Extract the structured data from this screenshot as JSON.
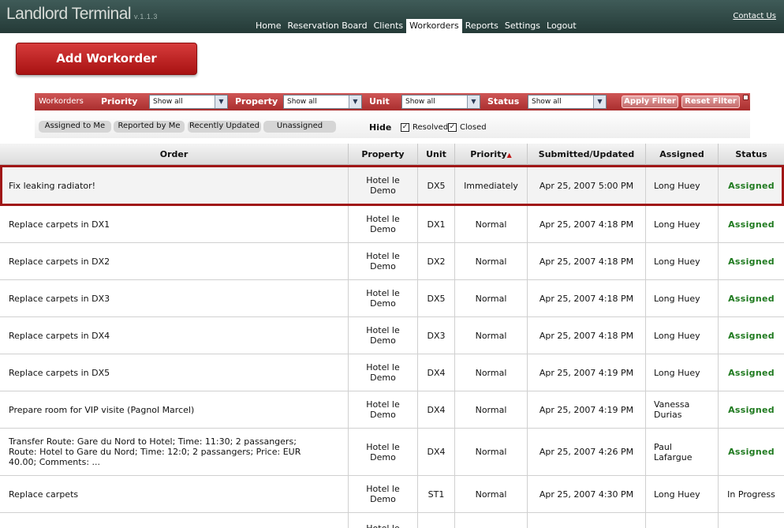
{
  "app": {
    "title": "Landlord Terminal",
    "version": "v.1.1.3",
    "contact": "Contact Us"
  },
  "nav": [
    {
      "label": "Home",
      "active": false
    },
    {
      "label": "Reservation Board",
      "active": false
    },
    {
      "label": "Clients",
      "active": false
    },
    {
      "label": "Workorders",
      "active": true
    },
    {
      "label": "Reports",
      "active": false
    },
    {
      "label": "Settings",
      "active": false
    },
    {
      "label": "Logout",
      "active": false
    }
  ],
  "add_button": "Add Workorder",
  "filter": {
    "section": "Workorders",
    "priority_label": "Priority",
    "priority_value": "Show all",
    "property_label": "Property",
    "property_value": "Show all",
    "unit_label": "Unit",
    "unit_value": "Show all",
    "status_label": "Status",
    "status_value": "Show all",
    "apply": "Apply Filter",
    "reset": "Reset Filter"
  },
  "quick_filters": [
    "Assigned to Me",
    "Reported by Me",
    "Recently Updated",
    "Unassigned"
  ],
  "hide": {
    "label": "Hide",
    "resolved": "Resolved",
    "closed": "Closed",
    "resolved_checked": true,
    "closed_checked": true
  },
  "columns": [
    "Order",
    "Property",
    "Unit",
    "Priority",
    "Submitted/Updated",
    "Assigned",
    "Status"
  ],
  "sort": {
    "column": "Priority"
  },
  "rows": [
    {
      "order": "Fix leaking radiator!",
      "property": "Hotel le Demo",
      "unit": "DX5",
      "priority": "Immediately",
      "submitted": "Apr 25, 2007 5:00 PM",
      "assigned": "Long Huey",
      "status": "Assigned",
      "selected": true
    },
    {
      "order": "Replace carpets in DX1",
      "property": "Hotel le Demo",
      "unit": "DX1",
      "priority": "Normal",
      "submitted": "Apr 25, 2007 4:18 PM",
      "assigned": "Long Huey",
      "status": "Assigned"
    },
    {
      "order": "Replace carpets in DX2",
      "property": "Hotel le Demo",
      "unit": "DX2",
      "priority": "Normal",
      "submitted": "Apr 25, 2007 4:18 PM",
      "assigned": "Long Huey",
      "status": "Assigned"
    },
    {
      "order": "Replace carpets in DX3",
      "property": "Hotel le Demo",
      "unit": "DX5",
      "priority": "Normal",
      "submitted": "Apr 25, 2007 4:18 PM",
      "assigned": "Long Huey",
      "status": "Assigned"
    },
    {
      "order": "Replace carpets in DX4",
      "property": "Hotel le Demo",
      "unit": "DX3",
      "priority": "Normal",
      "submitted": "Apr 25, 2007 4:18 PM",
      "assigned": "Long Huey",
      "status": "Assigned"
    },
    {
      "order": "Replace carpets in DX5",
      "property": "Hotel le Demo",
      "unit": "DX4",
      "priority": "Normal",
      "submitted": "Apr 25, 2007 4:19 PM",
      "assigned": "Long Huey",
      "status": "Assigned"
    },
    {
      "order": "Prepare room for VIP visite (Pagnol Marcel)",
      "property": "Hotel le Demo",
      "unit": "DX4",
      "priority": "Normal",
      "submitted": "Apr 25, 2007 4:19 PM",
      "assigned": "Vanessa Durias",
      "status": "Assigned"
    },
    {
      "order": "Transfer Route: Gare du Nord to Hotel; Time: 11:30; 2 passangers; Route: Hotel to Gare du Nord; Time: 12:0; 2 passangers; Price: EUR 40.00; Comments: ...",
      "property": "Hotel le Demo",
      "unit": "DX4",
      "priority": "Normal",
      "submitted": "Apr 25, 2007 4:26 PM",
      "assigned": "Paul Lafargue",
      "status": "Assigned"
    },
    {
      "order": "Replace carpets",
      "property": "Hotel le Demo",
      "unit": "ST1",
      "priority": "Normal",
      "submitted": "Apr 25, 2007 4:30 PM",
      "assigned": "Long Huey",
      "status": "In Progress"
    },
    {
      "order": "",
      "property": "Hotel le",
      "unit": "",
      "priority": "",
      "submitted": "",
      "assigned": "",
      "status": ""
    }
  ],
  "colors": {
    "header": "#2f4845",
    "accent_red": "#a92d2d",
    "assigned_green": "#1f7a1f"
  }
}
